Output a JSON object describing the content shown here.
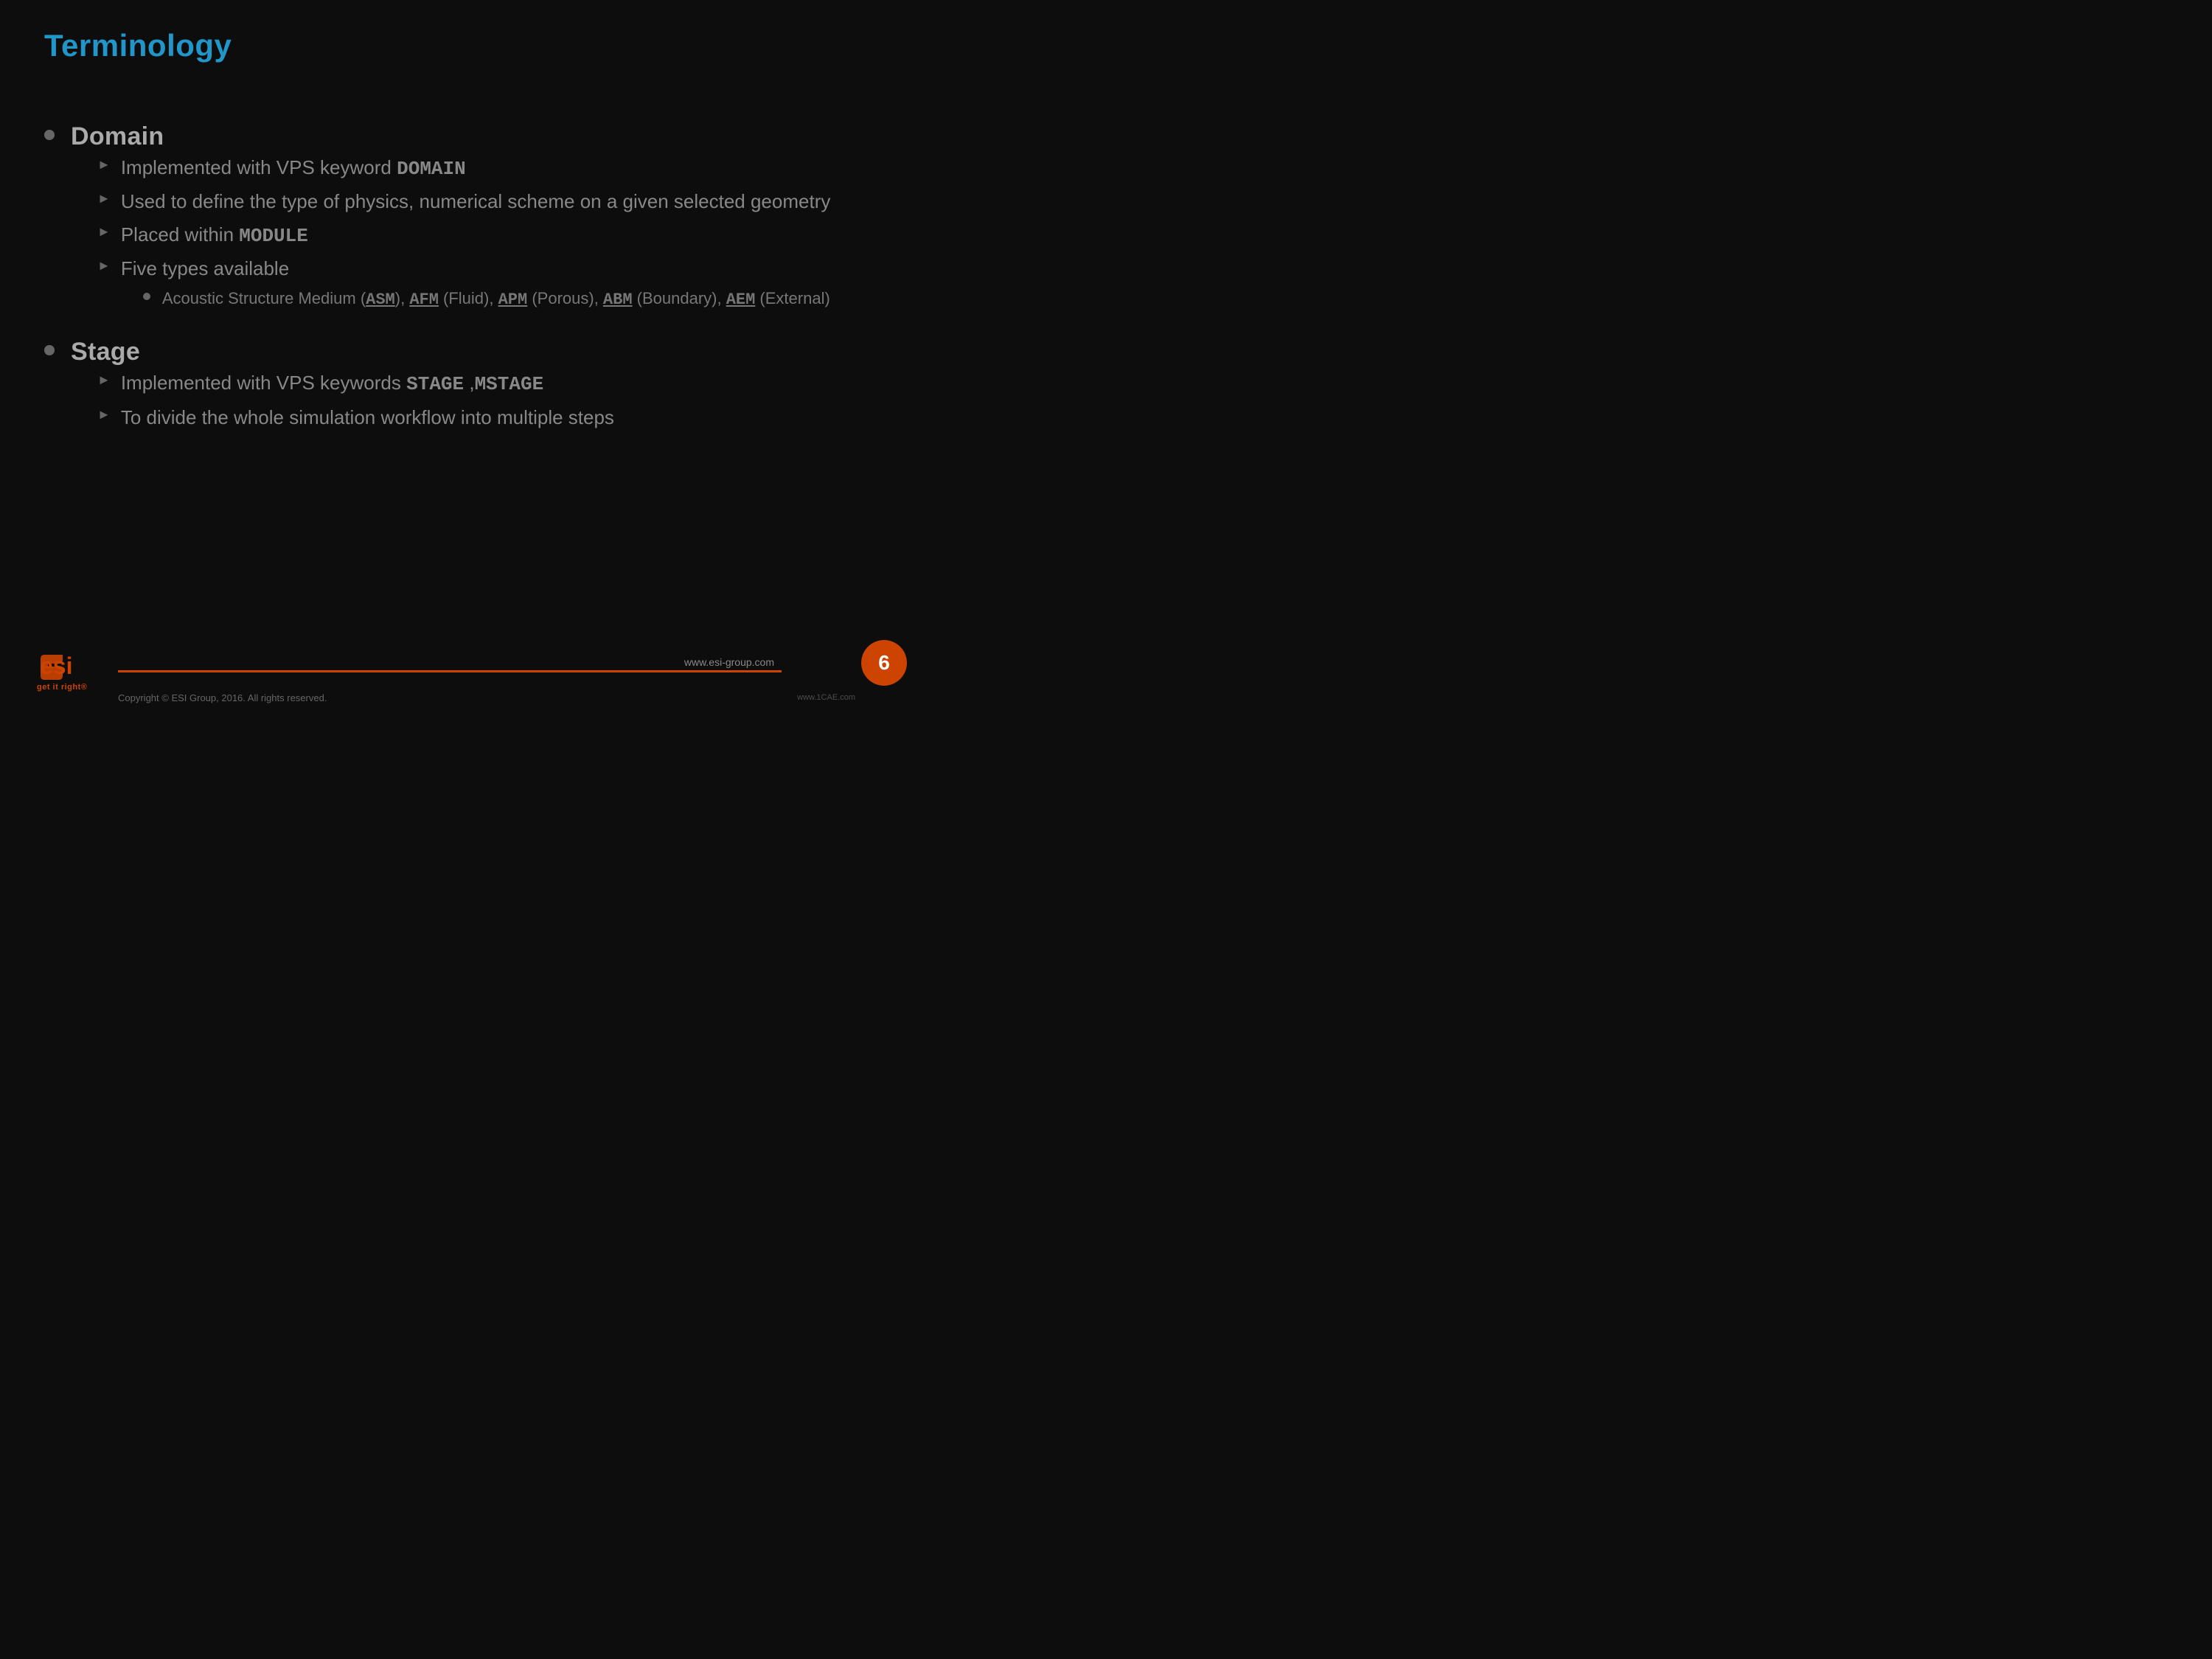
{
  "slide": {
    "title": "Terminology",
    "page_number": "6",
    "footer": {
      "url": "www.esi-group.com",
      "copyright": "Copyright © ESI Group, 2016. All rights reserved.",
      "tagline": "get it right®",
      "watermark": "www.1CAE.com"
    },
    "domain": {
      "label": "Domain",
      "sub_items": [
        {
          "text_parts": [
            {
              "text": "Implemented with VPS keyword ",
              "bold": false
            },
            {
              "text": "DOMAIN",
              "bold": true,
              "mono": true
            }
          ]
        },
        {
          "text_parts": [
            {
              "text": "Used to define the type of physics, numerical scheme on a given selected geometry",
              "bold": false
            }
          ]
        },
        {
          "text_parts": [
            {
              "text": "Placed within ",
              "bold": false
            },
            {
              "text": "MODULE",
              "bold": true,
              "mono": true
            }
          ]
        },
        {
          "text_parts": [
            {
              "text": "Five types available",
              "bold": false
            }
          ],
          "sub_sub": [
            {
              "text_parts": [
                {
                  "text": "Acoustic Structure Medium (",
                  "bold": false
                },
                {
                  "text": "ASM",
                  "bold": true,
                  "mono": true
                },
                {
                  "text": "), ",
                  "bold": false
                },
                {
                  "text": "AFM",
                  "bold": true,
                  "mono": true
                },
                {
                  "text": " (Fluid), ",
                  "bold": false
                },
                {
                  "text": "APM",
                  "bold": true,
                  "mono": true
                },
                {
                  "text": " (Porous), ",
                  "bold": false
                },
                {
                  "text": "ABM",
                  "bold": true,
                  "mono": true
                },
                {
                  "text": " (Boundary), ",
                  "bold": false
                },
                {
                  "text": "AEM",
                  "bold": true,
                  "mono": true
                },
                {
                  "text": " (External)",
                  "bold": false
                }
              ]
            }
          ]
        }
      ]
    },
    "stage": {
      "label": "Stage",
      "sub_items": [
        {
          "text_parts": [
            {
              "text": "Implemented with VPS keywords ",
              "bold": false
            },
            {
              "text": "STAGE",
              "bold": true,
              "mono": true
            },
            {
              "text": " ,",
              "bold": false
            },
            {
              "text": "MSTAGE",
              "bold": true,
              "mono": true
            }
          ]
        },
        {
          "text_parts": [
            {
              "text": "To divide the whole simulation workflow into multiple steps",
              "bold": false
            }
          ]
        }
      ]
    }
  }
}
